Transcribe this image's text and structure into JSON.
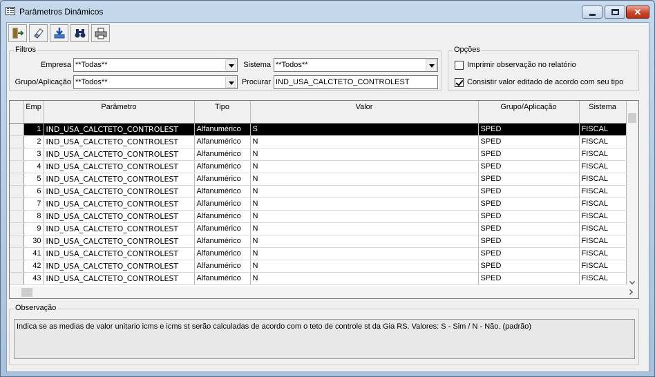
{
  "window": {
    "title": "Parâmetros Dinâmicos",
    "close_symbol": "✕"
  },
  "toolbar": {
    "items": [
      {
        "name": "exit-icon",
        "color": "#2d6b1f"
      },
      {
        "name": "eraser-icon",
        "color": "#444444"
      },
      {
        "name": "download-icon",
        "color": "#1c4f9c"
      },
      {
        "name": "binoculars-icon",
        "color": "#1e2d5c"
      },
      {
        "name": "printer-icon",
        "color": "#333333"
      }
    ]
  },
  "filters": {
    "title": "Filtros",
    "empresa_label": "Empresa",
    "empresa_value": "**Todas**",
    "sistema_label": "Sistema",
    "sistema_value": "**Todos**",
    "grupo_label": "Grupo/Aplicação",
    "grupo_value": "**Todos**",
    "procurar_label": "Procurar",
    "procurar_value": "IND_USA_CALCTETO_CONTROLEST"
  },
  "options": {
    "title": "Opções",
    "opt1_label": "Imprimir observação no relatório",
    "opt1_checked": false,
    "opt2_label": "Consistir valor editado de acordo com seu tipo",
    "opt2_checked": true
  },
  "grid": {
    "headers": [
      "Emp",
      "Parâmetro",
      "Tipo",
      "Valor",
      "Grupo/Aplicação",
      "Sistema"
    ],
    "rows": [
      {
        "emp": "1",
        "param": "IND_USA_CALCTETO_CONTROLEST",
        "tipo": "Alfanumérico",
        "valor": "S",
        "grupo": "SPED",
        "sistema": "FISCAL",
        "selected": true
      },
      {
        "emp": "2",
        "param": "IND_USA_CALCTETO_CONTROLEST",
        "tipo": "Alfanumérico",
        "valor": "N",
        "grupo": "SPED",
        "sistema": "FISCAL"
      },
      {
        "emp": "3",
        "param": "IND_USA_CALCTETO_CONTROLEST",
        "tipo": "Alfanumérico",
        "valor": "N",
        "grupo": "SPED",
        "sistema": "FISCAL"
      },
      {
        "emp": "4",
        "param": "IND_USA_CALCTETO_CONTROLEST",
        "tipo": "Alfanumérico",
        "valor": "N",
        "grupo": "SPED",
        "sistema": "FISCAL"
      },
      {
        "emp": "5",
        "param": "IND_USA_CALCTETO_CONTROLEST",
        "tipo": "Alfanumérico",
        "valor": "N",
        "grupo": "SPED",
        "sistema": "FISCAL"
      },
      {
        "emp": "6",
        "param": "IND_USA_CALCTETO_CONTROLEST",
        "tipo": "Alfanumérico",
        "valor": "N",
        "grupo": "SPED",
        "sistema": "FISCAL"
      },
      {
        "emp": "7",
        "param": "IND_USA_CALCTETO_CONTROLEST",
        "tipo": "Alfanumérico",
        "valor": "N",
        "grupo": "SPED",
        "sistema": "FISCAL"
      },
      {
        "emp": "8",
        "param": "IND_USA_CALCTETO_CONTROLEST",
        "tipo": "Alfanumérico",
        "valor": "N",
        "grupo": "SPED",
        "sistema": "FISCAL"
      },
      {
        "emp": "9",
        "param": "IND_USA_CALCTETO_CONTROLEST",
        "tipo": "Alfanumérico",
        "valor": "N",
        "grupo": "SPED",
        "sistema": "FISCAL"
      },
      {
        "emp": "30",
        "param": "IND_USA_CALCTETO_CONTROLEST",
        "tipo": "Alfanumérico",
        "valor": "N",
        "grupo": "SPED",
        "sistema": "FISCAL"
      },
      {
        "emp": "41",
        "param": "IND_USA_CALCTETO_CONTROLEST",
        "tipo": "Alfanumérico",
        "valor": "N",
        "grupo": "SPED",
        "sistema": "FISCAL"
      },
      {
        "emp": "42",
        "param": "IND_USA_CALCTETO_CONTROLEST",
        "tipo": "Alfanumérico",
        "valor": "N",
        "grupo": "SPED",
        "sistema": "FISCAL"
      },
      {
        "emp": "43",
        "param": "IND_USA_CALCTETO_CONTROLEST",
        "tipo": "Alfanumérico",
        "valor": "N",
        "grupo": "SPED",
        "sistema": "FISCAL"
      }
    ]
  },
  "observacao": {
    "title": "Observação",
    "text": "Indica se as medias de valor unitario icms e icms st serão calculadas de acordo com o teto de controle st da Gia RS. Valores: S - Sim / N - Não. (padrão)"
  }
}
